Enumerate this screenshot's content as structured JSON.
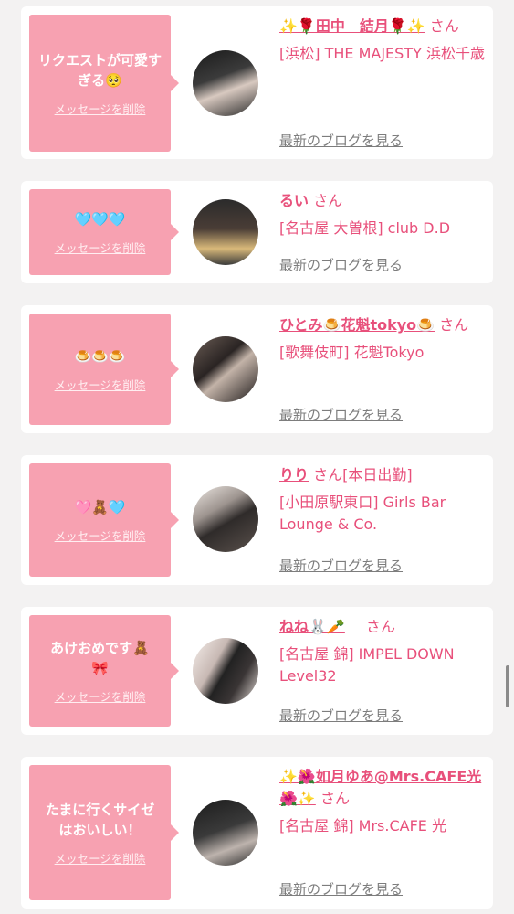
{
  "accent_color": "#e8507b",
  "bubble_color": "#f7a1b1",
  "entries": [
    {
      "message": "リクエストが可愛すぎる🥺",
      "delete_label": "メッセージを削除",
      "name": "✨🌹田中　結月🌹✨",
      "suffix": "さん",
      "shop": "[浜松] THE MAJESTY 浜松千歳",
      "blog_label": "最新のブログを見る"
    },
    {
      "message": "🩵🩵🩵",
      "delete_label": "メッセージを削除",
      "name": "るい",
      "suffix": "さん",
      "shop": "[名古屋 大曽根] club D.D",
      "blog_label": "最新のブログを見る"
    },
    {
      "message": "🍮🍮🍮",
      "delete_label": "メッセージを削除",
      "name": "ひとみ🍮花魁tokyo🍮",
      "suffix": "さん",
      "shop": "[歌舞伎町] 花魁Tokyo",
      "blog_label": "最新のブログを見る"
    },
    {
      "message": "🩷🧸🩵",
      "delete_label": "メッセージを削除",
      "name": "りり",
      "suffix": "さん[本日出勤]",
      "shop": "[小田原駅東口] Girls Bar Lounge & Co.",
      "blog_label": "最新のブログを見る"
    },
    {
      "message": "あけおめです🧸🎀",
      "delete_label": "メッセージを削除",
      "name": "ねね🐰🥕",
      "suffix": "さん",
      "shop": "[名古屋 錦] IMPEL DOWN Level32",
      "blog_label": "最新のブログを見る"
    },
    {
      "message": "たまに行くサイゼはおいしい！",
      "delete_label": "メッセージを削除",
      "name": "✨🌺如月ゆあ@Mrs.CAFE光🌺✨",
      "suffix": "さん",
      "shop": "[名古屋 錦] Mrs.CAFE 光",
      "blog_label": "最新のブログを見る"
    }
  ]
}
